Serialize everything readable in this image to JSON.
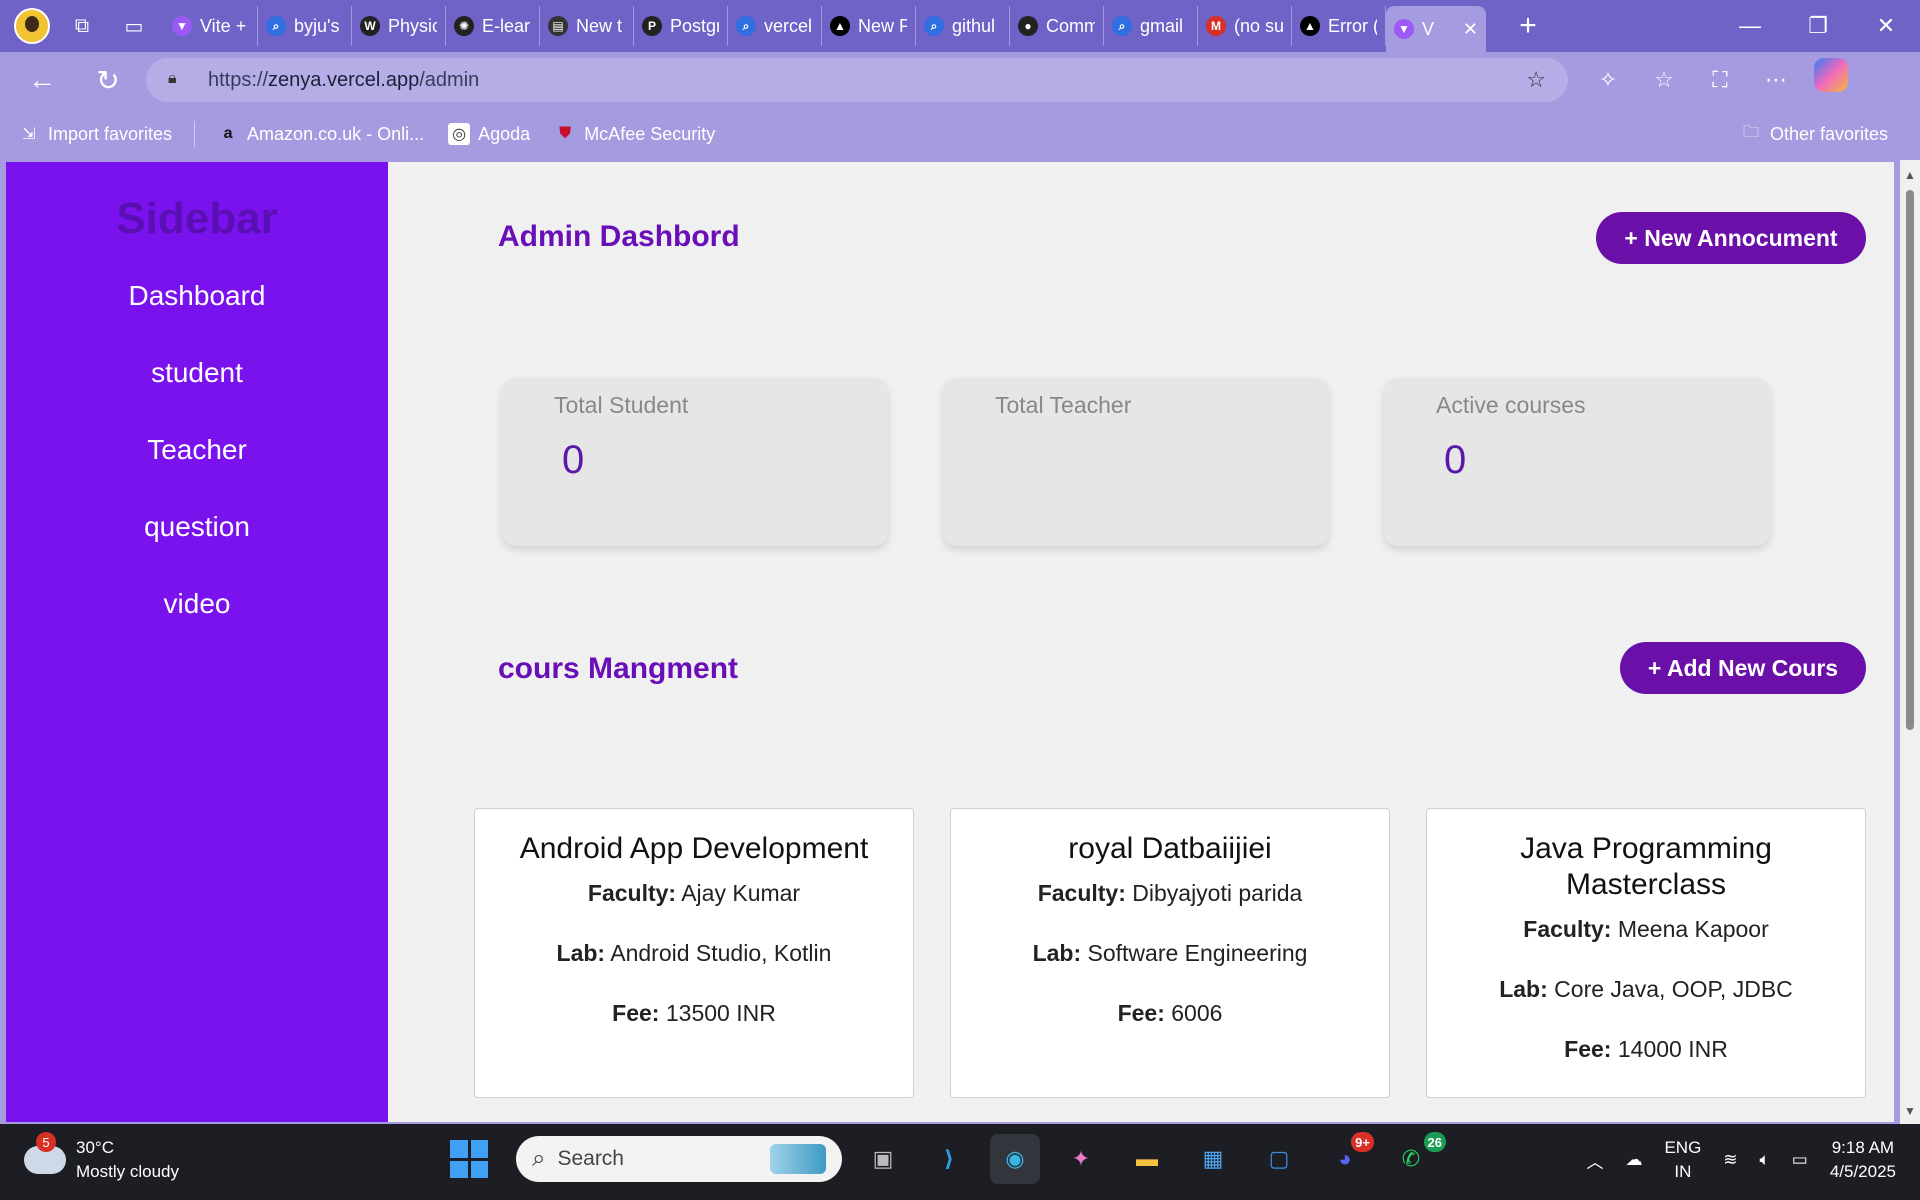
{
  "browser": {
    "tabs": [
      {
        "label": "Vite +",
        "icon": "vite-icon",
        "color": "#9b59f6"
      },
      {
        "label": "byju's",
        "icon": "search-icon",
        "color": "#2f6fe0"
      },
      {
        "label": "Physic",
        "icon": "wordpress-icon",
        "color": "#222"
      },
      {
        "label": "E-learn",
        "icon": "openai-icon",
        "color": "#222"
      },
      {
        "label": "New t",
        "icon": "page-icon",
        "color": "#333"
      },
      {
        "label": "Postgr",
        "icon": "postgres-icon",
        "color": "#222"
      },
      {
        "label": "vercel",
        "icon": "search-icon",
        "color": "#2f6fe0"
      },
      {
        "label": "New P",
        "icon": "vercel-icon",
        "color": "#000"
      },
      {
        "label": "githul",
        "icon": "search-icon",
        "color": "#2f6fe0"
      },
      {
        "label": "Comm",
        "icon": "github-icon",
        "color": "#222"
      },
      {
        "label": "gmail",
        "icon": "search-icon",
        "color": "#2f6fe0"
      },
      {
        "label": "(no su",
        "icon": "gmail-icon",
        "color": "#d93025"
      },
      {
        "label": "Error (",
        "icon": "vercel-icon",
        "color": "#000"
      },
      {
        "label": "V",
        "icon": "vite-icon",
        "color": "#9b59f6",
        "active": true
      }
    ],
    "url_scheme": "https://",
    "url_host": "zenya.vercel.app",
    "url_path": "/admin",
    "favorites": [
      {
        "label": "Import favorites",
        "icon": "import-icon"
      },
      {
        "label": "Amazon.co.uk - Onli...",
        "icon": "amazon-icon"
      },
      {
        "label": "Agoda",
        "icon": "agoda-icon"
      },
      {
        "label": "McAfee Security",
        "icon": "mcafee-icon"
      }
    ],
    "other_favorites": "Other favorites"
  },
  "sidebar": {
    "title": "Sidebar",
    "items": [
      {
        "label": "Dashboard"
      },
      {
        "label": "student"
      },
      {
        "label": "Teacher"
      },
      {
        "label": "question"
      },
      {
        "label": "video"
      }
    ]
  },
  "dashboard": {
    "title": "Admin Dashbord",
    "announcement_button": "+ New Annocument",
    "stats": [
      {
        "label": "Total Student",
        "value": "0"
      },
      {
        "label": "Total Teacher",
        "value": ""
      },
      {
        "label": "Active courses",
        "value": "0"
      }
    ]
  },
  "courses": {
    "title": "cours Mangment",
    "add_button": "+ Add New Cours",
    "faculty_label": "Faculty:",
    "lab_label": "Lab:",
    "fee_label": "Fee:",
    "items": [
      {
        "name": "Android App Development",
        "faculty": "Ajay Kumar",
        "lab": "Android Studio, Kotlin",
        "fee": "13500 INR"
      },
      {
        "name": "royal Datbaiijiei",
        "faculty": "Dibyajyoti parida",
        "lab": "Software Engineering",
        "fee": "6006"
      },
      {
        "name": "Java Programming Masterclass",
        "faculty": "Meena Kapoor",
        "lab": "Core Java, OOP, JDBC",
        "fee": "14000 INR"
      }
    ]
  },
  "taskbar": {
    "weather_badge": "5",
    "temperature": "30°C",
    "weather_desc": "Mostly cloudy",
    "search_placeholder": "Search",
    "discord_badge": "9+",
    "whatsapp_badge": "26",
    "lang_1": "ENG",
    "lang_2": "IN",
    "time": "9:18 AM",
    "date": "4/5/2025"
  },
  "colors": {
    "sidebar_bg": "#7a12ee",
    "accent": "#6a0fa8",
    "browser_frame": "#6f63c7"
  }
}
